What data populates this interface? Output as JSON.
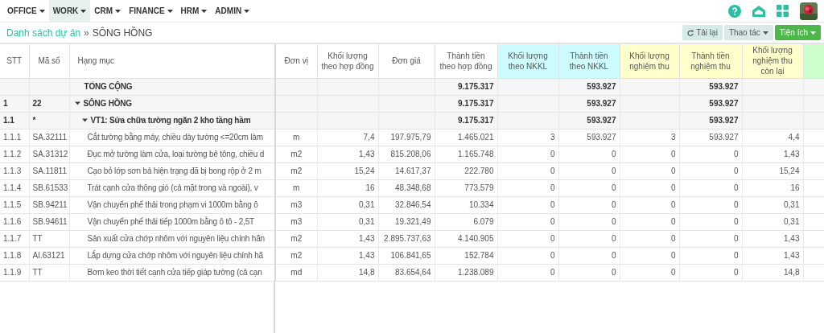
{
  "menu": [
    {
      "label": "OFFICE",
      "selected": false
    },
    {
      "label": "WORK",
      "selected": true
    },
    {
      "label": "CRM",
      "selected": false
    },
    {
      "label": "FINANCE",
      "selected": false
    },
    {
      "label": "HRM",
      "selected": false
    },
    {
      "label": "ADMIN",
      "selected": false
    }
  ],
  "breadcrumb": {
    "link": "Danh sách dự án",
    "separator": "»",
    "current": "SÔNG HỒNG"
  },
  "actions": [
    {
      "label": "Tải lại",
      "kind": "reload"
    },
    {
      "label": "Thao tác",
      "kind": "dropdown"
    },
    {
      "label": "Tiện ích",
      "kind": "primary"
    }
  ],
  "table": {
    "columns": [
      {
        "label": "STT",
        "kind": "plain"
      },
      {
        "label": "Mã số",
        "kind": "plain"
      },
      {
        "label": "Hạng mục",
        "kind": "plain"
      },
      {
        "label": "Đơn vị",
        "kind": "plain"
      },
      {
        "label": "Khối lượng theo hợp đồng",
        "kind": "plain"
      },
      {
        "label": "Đơn giá",
        "kind": "plain"
      },
      {
        "label": "Thành tiền theo hợp đồng",
        "kind": "plain"
      },
      {
        "label": "Khối lượng theo NKKL",
        "kind": "nkkl"
      },
      {
        "label": "Thành tiền theo NKKL",
        "kind": "nkkl"
      },
      {
        "label": "Khối lượng nghiệm thu",
        "kind": "accept"
      },
      {
        "label": "Thành tiền nghiệm thu",
        "kind": "accept"
      },
      {
        "label": "Khối lượng nghiệm thu còn lại",
        "kind": "accept"
      },
      {
        "kind": "extra"
      }
    ],
    "rows": [
      {
        "kind": "total",
        "name": "TỔNG CỘNG",
        "contract_amount": "9.175.317",
        "nkkl_amount": "593.927",
        "accepted_amount": "593.927"
      },
      {
        "kind": "group",
        "stt": "1",
        "code": "22",
        "name": "SÔNG HỒNG",
        "expanded": true,
        "contract_amount": "9.175.317",
        "nkkl_amount": "593.927",
        "accepted_amount": "593.927",
        "children": [
          {
            "kind": "group",
            "stt": "1.1",
            "code": "*",
            "name": "VT1: Sửa chữa tường ngăn 2 kho tầng hầm",
            "expanded": true,
            "contract_amount": "9.175.317",
            "nkkl_amount": "593.927",
            "accepted_amount": "593.927",
            "children": [
              {
                "kind": "item",
                "stt": "1.1.1",
                "code": "SA.32111",
                "name": "Cắt tường bằng máy, chiều dày tường <=20cm làm",
                "unit": "m",
                "contract_qty": "7,4",
                "unit_price": "197.975,79",
                "contract_amount": "1.465.021",
                "nkkl_qty": "3",
                "nkkl_amount": "593.927",
                "accepted_qty": "3",
                "accepted_amount": "593.927",
                "remaining_qty": "4,4"
              },
              {
                "kind": "item",
                "stt": "1.1.2",
                "code": "SA.31312",
                "name": "Đục mở tường làm cửa, loại tường bê tông, chiều d",
                "unit": "m2",
                "contract_qty": "1,43",
                "unit_price": "815.208,06",
                "contract_amount": "1.165.748",
                "nkkl_qty": "0",
                "nkkl_amount": "0",
                "accepted_qty": "0",
                "accepted_amount": "0",
                "remaining_qty": "1,43"
              },
              {
                "kind": "item",
                "stt": "1.1.3",
                "code": "SA.11811",
                "name": "Cạo bỏ lớp sơn bả hiện trạng đã bị bong rộp ở 2 m",
                "unit": "m2",
                "contract_qty": "15,24",
                "unit_price": "14.617,37",
                "contract_amount": "222.780",
                "nkkl_qty": "0",
                "nkkl_amount": "0",
                "accepted_qty": "0",
                "accepted_amount": "0",
                "remaining_qty": "15,24"
              },
              {
                "kind": "item",
                "stt": "1.1.4",
                "code": "SB.61533",
                "name": "Trát cạnh cửa thông gió (cả mặt trong và ngoài), v",
                "unit": "m",
                "contract_qty": "16",
                "unit_price": "48.348,68",
                "contract_amount": "773.579",
                "nkkl_qty": "0",
                "nkkl_amount": "0",
                "accepted_qty": "0",
                "accepted_amount": "0",
                "remaining_qty": "16"
              },
              {
                "kind": "item",
                "stt": "1.1.5",
                "code": "SB.94211",
                "name": "Vận chuyển phế thải trong phạm vi 1000m bằng ô",
                "unit": "m3",
                "contract_qty": "0,31",
                "unit_price": "32.846,54",
                "contract_amount": "10.334",
                "nkkl_qty": "0",
                "nkkl_amount": "0",
                "accepted_qty": "0",
                "accepted_amount": "0",
                "remaining_qty": "0,31"
              },
              {
                "kind": "item",
                "stt": "1.1.6",
                "code": "SB.94611",
                "name": "Vận chuyển phế thải tiếp 1000m bằng ô tô - 2,5T",
                "unit": "m3",
                "contract_qty": "0,31",
                "unit_price": "19.321,49",
                "contract_amount": "6.079",
                "nkkl_qty": "0",
                "nkkl_amount": "0",
                "accepted_qty": "0",
                "accepted_amount": "0",
                "remaining_qty": "0,31"
              },
              {
                "kind": "item",
                "stt": "1.1.7",
                "code": "TT",
                "name": "Sản xuất cửa chớp nhôm với nguyên liệu chính hãn",
                "unit": "m2",
                "contract_qty": "1,43",
                "unit_price": "2.895.737,63",
                "contract_amount": "4.140.905",
                "nkkl_qty": "0",
                "nkkl_amount": "0",
                "accepted_qty": "0",
                "accepted_amount": "0",
                "remaining_qty": "1,43"
              },
              {
                "kind": "item",
                "stt": "1.1.8",
                "code": "AI.63121",
                "name": "Lắp dựng cửa chớp nhôm với nguyên liệu chính hã",
                "unit": "m2",
                "contract_qty": "1,43",
                "unit_price": "106.841,65",
                "contract_amount": "152.784",
                "nkkl_qty": "0",
                "nkkl_amount": "0",
                "accepted_qty": "0",
                "accepted_amount": "0",
                "remaining_qty": "1,43"
              },
              {
                "kind": "item",
                "stt": "1.1.9",
                "code": "TT",
                "name": "Bơm keo thời tiết cạnh cửa tiếp giáp tường (cả cạn",
                "unit": "md",
                "contract_qty": "14,8",
                "unit_price": "83.654,64",
                "contract_amount": "1.238.089",
                "nkkl_qty": "0",
                "nkkl_amount": "0",
                "accepted_qty": "0",
                "accepted_amount": "0",
                "remaining_qty": "14,8"
              }
            ]
          }
        ]
      }
    ]
  }
}
